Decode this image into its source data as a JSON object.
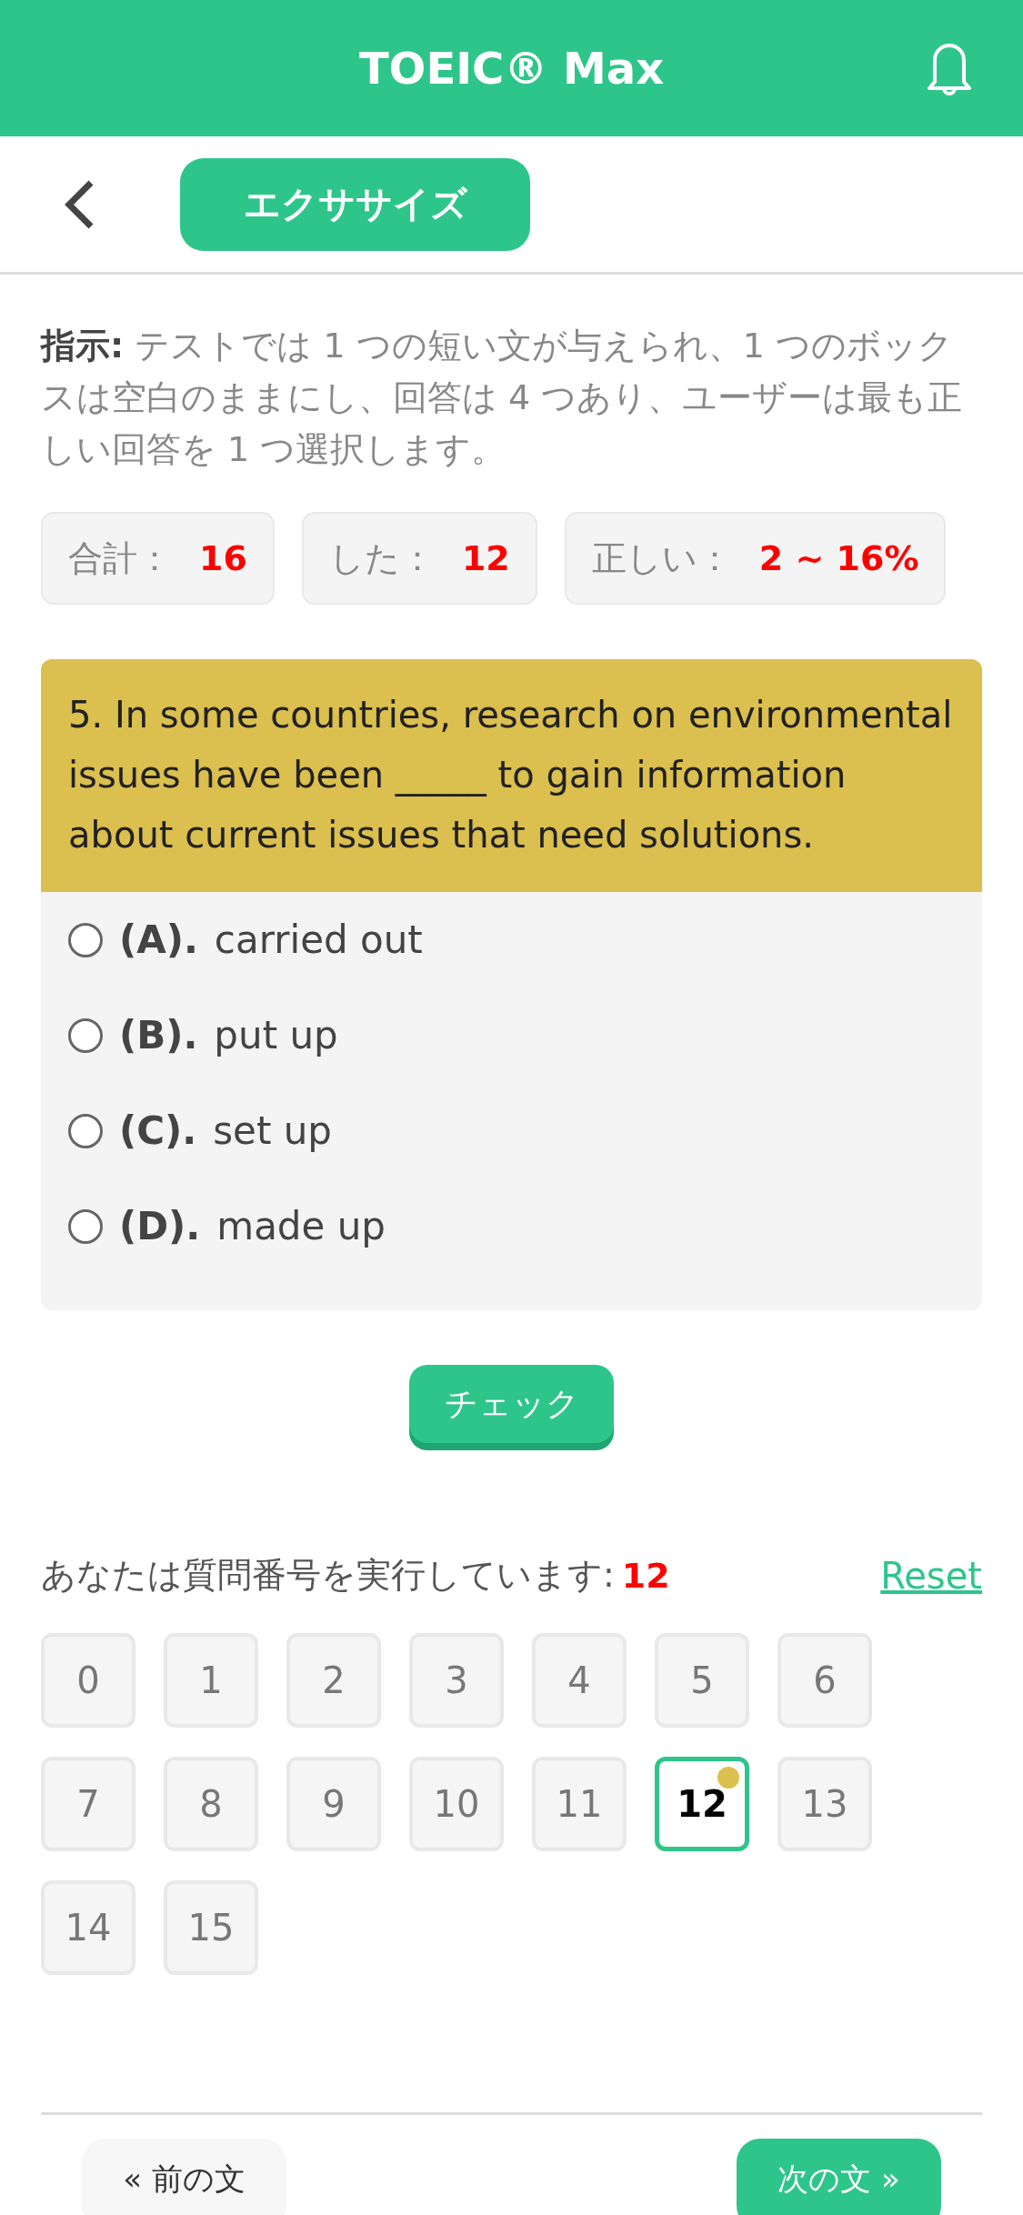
{
  "header": {
    "title": "TOEIC® Max"
  },
  "nav": {
    "tab": "エクササイズ"
  },
  "instructions": {
    "label": "指示:",
    "text": "テストでは 1 つの短い文が与えられ、1 つのボックスは空白のままにし、回答は 4 つあり、ユーザーは最も正しい回答を 1 つ選択します。"
  },
  "stats": [
    {
      "label": "合計：",
      "value": "16"
    },
    {
      "label": "した：",
      "value": "12"
    },
    {
      "label": "正しい：",
      "value": "2 ~ 16%"
    }
  ],
  "question": {
    "text": "5. In some countries, research on environmental issues have been _____ to gain information about current issues that need solutions.",
    "options": [
      {
        "letter": "(A).",
        "text": "carried out",
        "selected": false
      },
      {
        "letter": "(B).",
        "text": "put up",
        "selected": false
      },
      {
        "letter": "(C).",
        "text": "set up",
        "selected": false
      },
      {
        "letter": "(D).",
        "text": "made up",
        "selected": false
      }
    ]
  },
  "check_button": "チェック",
  "progress": {
    "label": "あなたは質問番号を実行しています:",
    "current": "12",
    "reset": "Reset"
  },
  "numbers": [
    {
      "label": "0",
      "selected": false
    },
    {
      "label": "1",
      "selected": false
    },
    {
      "label": "2",
      "selected": false
    },
    {
      "label": "3",
      "selected": false
    },
    {
      "label": "4",
      "selected": false
    },
    {
      "label": "5",
      "selected": false
    },
    {
      "label": "6",
      "selected": false
    },
    {
      "label": "7",
      "selected": false
    },
    {
      "label": "8",
      "selected": false
    },
    {
      "label": "9",
      "selected": false
    },
    {
      "label": "10",
      "selected": false
    },
    {
      "label": "11",
      "selected": false
    },
    {
      "label": "12",
      "selected": true
    },
    {
      "label": "13",
      "selected": false
    },
    {
      "label": "14",
      "selected": false
    },
    {
      "label": "15",
      "selected": false
    }
  ],
  "footer": {
    "prev": "« 前の文",
    "next": "次の文 »"
  }
}
